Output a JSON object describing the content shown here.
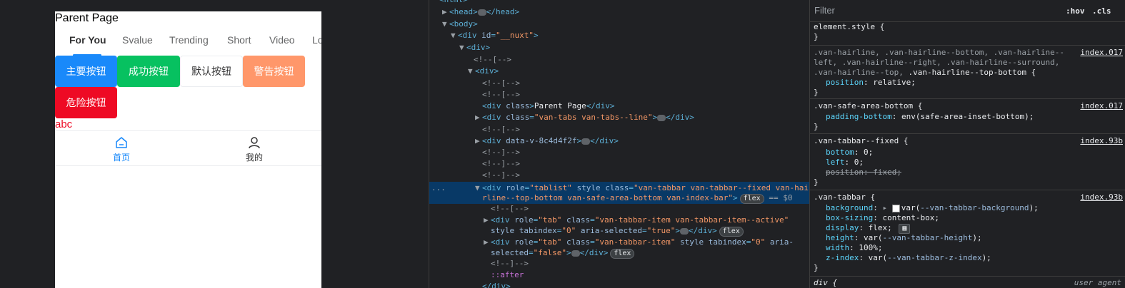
{
  "preview": {
    "page_title": "Parent Page",
    "tabs": [
      {
        "label": "For You",
        "active": true
      },
      {
        "label": "Svalue",
        "active": false
      },
      {
        "label": "Trending",
        "active": false
      },
      {
        "label": "Short",
        "active": false
      },
      {
        "label": "Video",
        "active": false
      },
      {
        "label": "Lo",
        "active": false
      }
    ],
    "buttons": [
      {
        "label": "主要按钮",
        "type": "primary"
      },
      {
        "label": "成功按钮",
        "type": "success"
      },
      {
        "label": "默认按钮",
        "type": "default"
      },
      {
        "label": "警告按钮",
        "type": "warning"
      },
      {
        "label": "危险按钮",
        "type": "danger"
      }
    ],
    "abc_text": "abc",
    "tabbar": [
      {
        "label": "首页",
        "icon": "home-icon",
        "active": true
      },
      {
        "label": "我的",
        "icon": "user-icon",
        "active": false
      }
    ],
    "colors": {
      "primary": "#1989fa",
      "success": "#07c160",
      "warning": "#ff976a",
      "danger": "#ee0a24"
    }
  },
  "elements": {
    "l0": "html",
    "l1_tag": "head",
    "l1_close": "/head",
    "l2": "body",
    "l3_tag": "div",
    "l3_attr": "id",
    "l3_val": "\"__nuxt\"",
    "l4": "div",
    "c_open": "<!--[-->",
    "c_close": "<!--]-->",
    "l5": "div",
    "parent_div_tag": "div",
    "parent_div_attr": "class",
    "parent_div_text": "Parent Page",
    "parent_div_close": "/div",
    "tabs_div_tag": "div",
    "tabs_div_attr": "class",
    "tabs_div_val": "\"van-tabs van-tabs--line\"",
    "tabs_div_close": "/div",
    "dv_tag": "div",
    "dv_attr": "data-v-8c4d4f2f",
    "dv_close": "/div",
    "sel_line1_a": "div",
    "sel_attr_role": "role",
    "sel_val_role": "\"tablist\"",
    "sel_attr_style": "style",
    "sel_attr_class": "class",
    "sel_val_class1": "\"van-tabbar van-tabbar--fixed van-hai",
    "sel_val_class2": "rline--top-bottom van-safe-area-bottom van-index-bar\"",
    "sel_badge": "flex",
    "sel_eq": "== $0",
    "sel_dots": "...",
    "t1_line1": "div",
    "t1_role_attr": "role",
    "t1_role_val": "\"tab\"",
    "t1_class_attr": "class",
    "t1_class_val": "\"van-tabbar-item van-tabbar-item--active\"",
    "t1_line2_style": "style",
    "t1_tabindex_attr": "tabindex",
    "t1_tabindex_val": "\"0\"",
    "t1_aria_attr": "aria-selected",
    "t1_aria_val": "\"true\"",
    "t1_close": "/div",
    "t1_badge": "flex",
    "t2_line1": "div",
    "t2_role_attr": "role",
    "t2_role_val": "\"tab\"",
    "t2_class_attr": "class",
    "t2_class_val": "\"van-tabbar-item\"",
    "t2_style": "style",
    "t2_tabindex_attr": "tabindex",
    "t2_tabindex_val": "\"0\"",
    "t2_aria_attr1": "aria-",
    "t2_aria_attr2": "selected",
    "t2_aria_val": "\"false\"",
    "t2_close": "/div",
    "t2_badge": "flex",
    "after": "::after",
    "last_close": "/div"
  },
  "styles": {
    "filter_placeholder": "Filter",
    "hov": ":hov",
    "cls": ".cls",
    "r1_sel": "element.style {",
    "brace_close": "}",
    "r2_sel1": ".van-hairline, .van-hairline--bottom, .van-hairline--",
    "r2_sel2": "left, .van-hairline--right, .van-hairline--surround,",
    "r2_sel3": ".van-hairline--top,",
    "r2_sel3b": ".van-hairline--top-bottom {",
    "r2_src": "index.017",
    "r2_p1": "position",
    "r2_v1": "relative;",
    "r3_sel": ".van-safe-area-bottom {",
    "r3_src": "index.017",
    "r3_p1": "padding-bottom",
    "r3_v1": "env(safe-area-inset-bottom);",
    "r4_sel": ".van-tabbar--fixed {",
    "r4_src": "index.93b",
    "r4_p1": "bottom",
    "r4_v1": "0;",
    "r4_p2": "left",
    "r4_v2": "0;",
    "r4_p3": "position: fixed;",
    "r5_sel": ".van-tabbar {",
    "r5_src": "index.93b",
    "r5_p1": "background",
    "r5_v1": "var(",
    "r5_v1b": "--van-tabbar-background",
    "r5_v1c": ");",
    "r5_p2": "box-sizing",
    "r5_v2": "content-box;",
    "r5_p3": "display",
    "r5_v3": "flex;",
    "r5_p4": "height",
    "r5_v4": "var(",
    "r5_v4b": "--van-tabbar-height",
    "r5_v4c": ");",
    "r5_p5": "width",
    "r5_v5": "100%;",
    "r5_p6": "z-index",
    "r5_v6": "var(",
    "r5_v6b": "--van-tabbar-z-index",
    "r5_v6c": ");",
    "r6_sel": "div {",
    "r6_src": "user agent"
  }
}
